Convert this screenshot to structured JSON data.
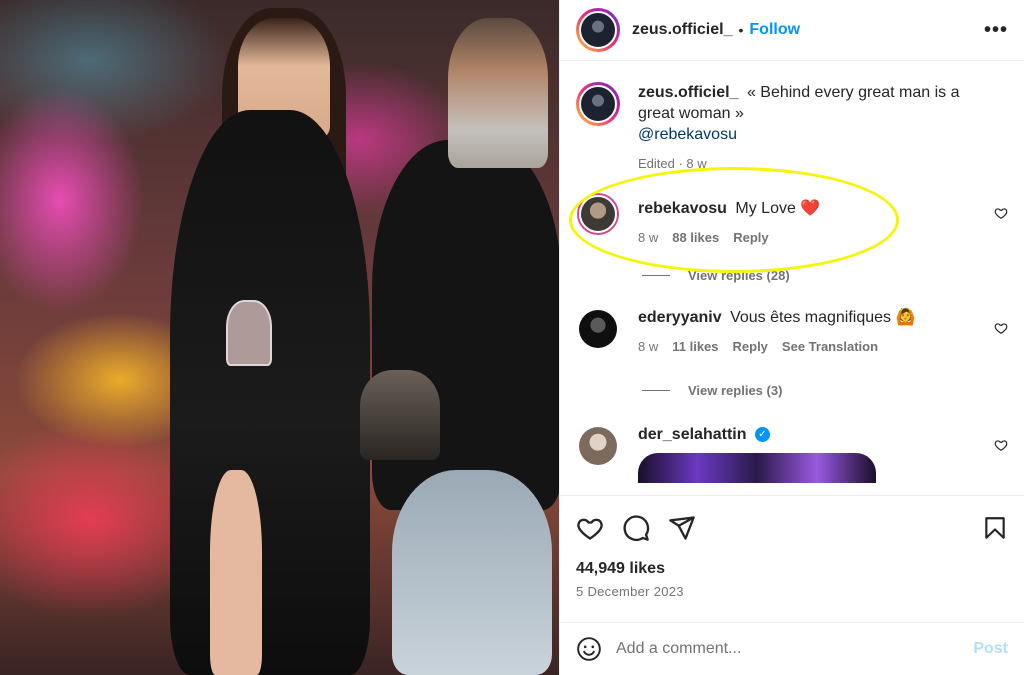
{
  "post": {
    "username": "zeus.officiel_",
    "follow_label": "Follow",
    "separator": "•",
    "more_icon": "more-horizontal-icon",
    "caption_text": "« Behind every great man is a great woman »",
    "caption_mention": "@rebekavosu",
    "caption_meta": "Edited · 8 w",
    "likes_text": "44,949 likes",
    "date_text": "5 December 2023"
  },
  "comments": [
    {
      "username": "rebekavosu",
      "text": "My Love ",
      "emoji": "❤️",
      "time": "8 w",
      "likes": "88 likes",
      "reply_label": "Reply",
      "view_replies": "View replies (28)"
    },
    {
      "username": "ederyyaniv",
      "text": "Vous êtes magnifiques ",
      "emoji": "🙆",
      "time": "8 w",
      "likes": "11 likes",
      "reply_label": "Reply",
      "translation_label": "See Translation",
      "view_replies": "View replies (3)"
    },
    {
      "username": "der_selahattin",
      "verified_mark": "✓"
    }
  ],
  "comment_box": {
    "placeholder": "Add a comment...",
    "post_label": "Post"
  },
  "colors": {
    "accent": "#0095f6",
    "highlight": "#f5f50a",
    "heart": "#e0245e"
  }
}
